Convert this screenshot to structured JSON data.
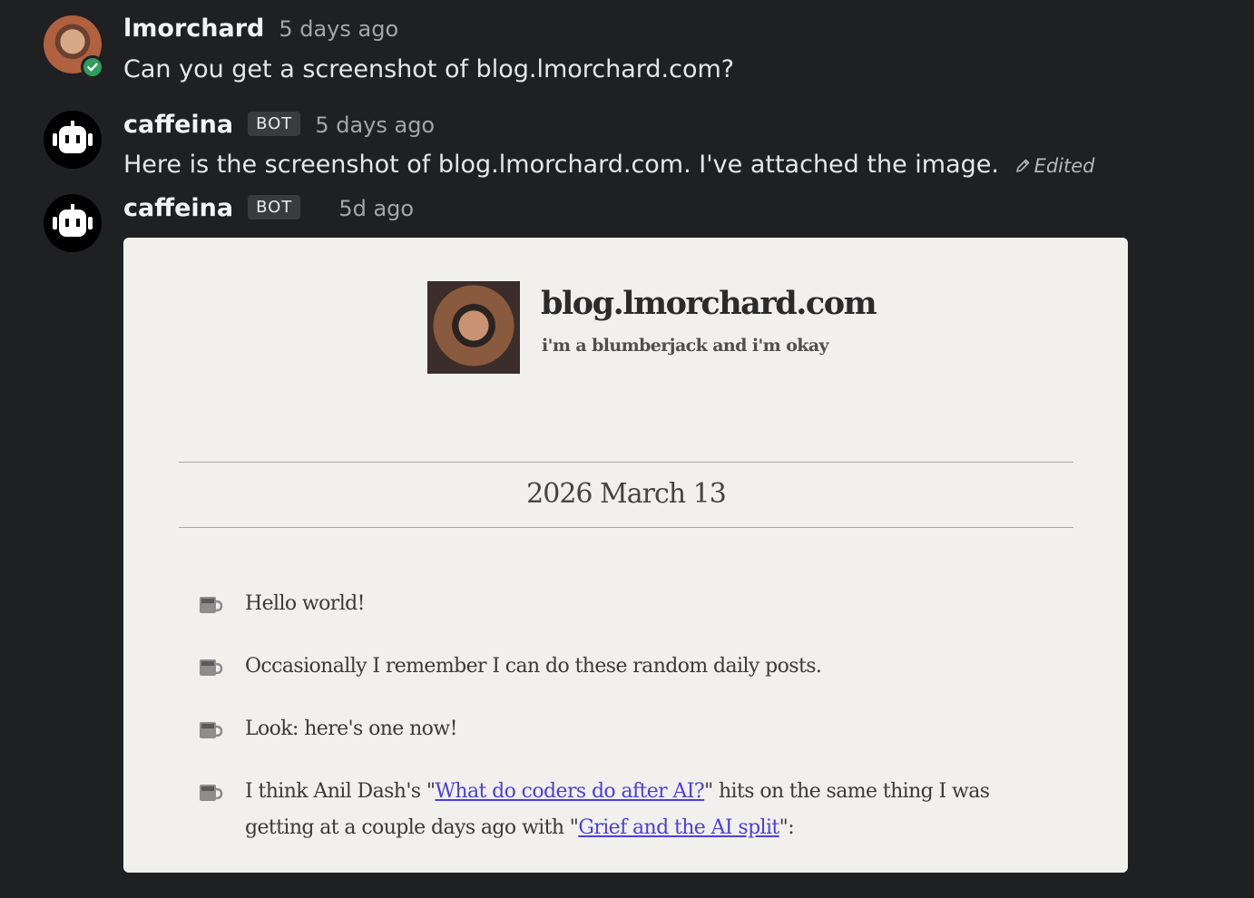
{
  "messages": [
    {
      "author": "lmorchard",
      "time": "5 days ago",
      "text": "Can you get a screenshot of blog.lmorchard.com?"
    },
    {
      "author": "caffeina",
      "badge": "BOT",
      "time": "5 days ago",
      "text": "Here is the screenshot of blog.lmorchard.com. I've attached the image.",
      "edited_label": "Edited"
    },
    {
      "author": "caffeina",
      "badge": "BOT",
      "time": "5d ago"
    }
  ],
  "screenshot": {
    "blog_title": "blog.lmorchard.com",
    "blog_tagline": "i'm a blumberjack and i'm okay",
    "date_heading": "2026 March 13",
    "posts": [
      {
        "text": "Hello world!"
      },
      {
        "text": "Occasionally I remember I can do these random daily posts."
      },
      {
        "text": "Look: here's one now!"
      },
      {
        "text_before": "I think Anil Dash's \"",
        "link1": "What do coders do after AI?",
        "text_middle": "\" hits on the same thing I was getting at a couple days ago with \"",
        "link2": "Grief and the AI split",
        "text_after": "\":"
      }
    ]
  },
  "colors": {
    "background": "#1f2022",
    "status_online": "#2e9c5e",
    "link": "#4b3ee0"
  }
}
